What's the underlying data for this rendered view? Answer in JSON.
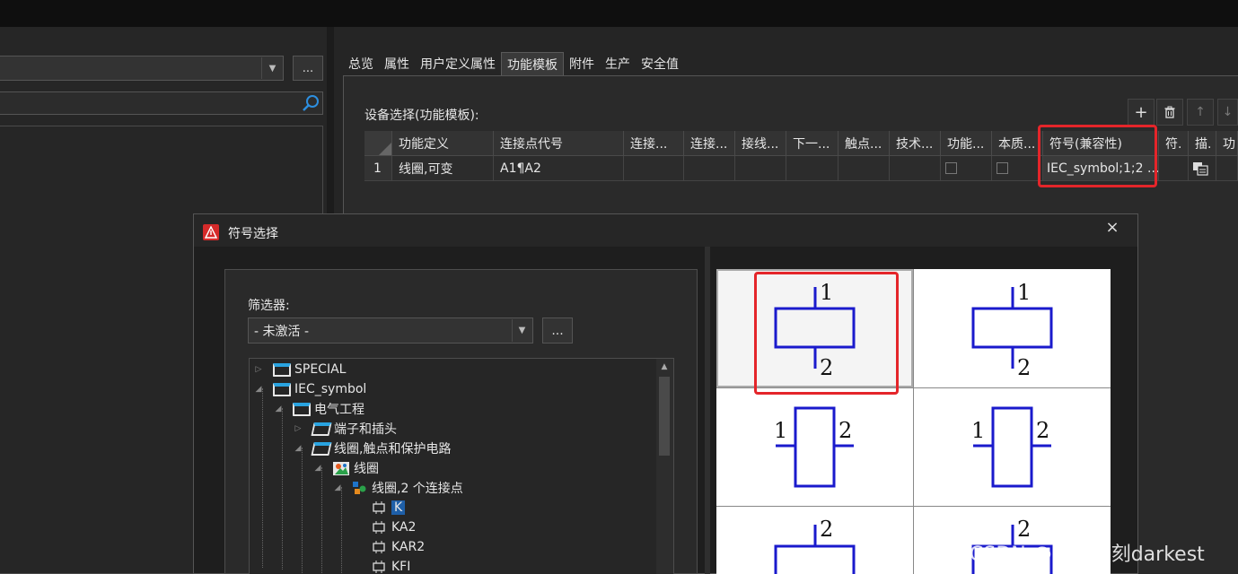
{
  "left_panel": {
    "combo_value": "",
    "more_label": "...",
    "search_placeholder": ""
  },
  "tabs": [
    {
      "label": "总览"
    },
    {
      "label": "属性"
    },
    {
      "label": "用户定义属性"
    },
    {
      "label": "功能模板",
      "active": true
    },
    {
      "label": "附件"
    },
    {
      "label": "生产"
    },
    {
      "label": "安全值"
    }
  ],
  "device_selection_label": "设备选择(功能模板):",
  "toolbar": {
    "add_icon": "+",
    "delete_icon": "trash-icon",
    "up_icon": "↑",
    "down_icon": "↓"
  },
  "grid": {
    "headers": [
      "功能定义",
      "连接点代号",
      "连接...",
      "连接...",
      "接线...",
      "下一...",
      "触点...",
      "技术...",
      "功能...",
      "本质...",
      "符号(兼容性)",
      "符.",
      "描.",
      "功"
    ],
    "row": {
      "index": "1",
      "function_definition": "线圈,可变",
      "connection_designation": "A1¶A2",
      "symbol_compat": "IEC_symbol;1;2 ..."
    }
  },
  "dialog": {
    "title": "符号选择",
    "close_icon": "×",
    "filter_label": "筛选器:",
    "filter_value": "- 未激活 -",
    "filter_more": "...",
    "tree": [
      {
        "label": "SPECIAL",
        "level": 0,
        "type": "folder",
        "expander": "▷"
      },
      {
        "label": "IEC_symbol",
        "level": 0,
        "type": "folder",
        "expander": "◢"
      },
      {
        "label": "电气工程",
        "level": 1,
        "type": "folder",
        "expander": "◢"
      },
      {
        "label": "端子和插头",
        "level": 2,
        "type": "folder-open",
        "expander": "▷"
      },
      {
        "label": "线圈,触点和保护电路",
        "level": 2,
        "type": "folder-open",
        "expander": "◢"
      },
      {
        "label": "线圈",
        "level": 3,
        "type": "image",
        "expander": "◢"
      },
      {
        "label": "线圈,2 个连接点",
        "level": 4,
        "type": "group",
        "expander": "◢"
      },
      {
        "label": "K",
        "level": 5,
        "type": "coil",
        "selected": true
      },
      {
        "label": "KA2",
        "level": 5,
        "type": "coil"
      },
      {
        "label": "KAR2",
        "level": 5,
        "type": "coil"
      },
      {
        "label": "KFI",
        "level": 5,
        "type": "coil"
      }
    ],
    "preview_cells": [
      {
        "orientation": "vertical",
        "top_pin": "1",
        "bottom_pin": "2"
      },
      {
        "orientation": "vertical",
        "top_pin": "1",
        "bottom_pin": "2"
      },
      {
        "orientation": "horizontal",
        "left_pin": "1",
        "right_pin": "2"
      },
      {
        "orientation": "horizontal",
        "left_pin": "1",
        "right_pin": "2"
      },
      {
        "orientation": "vertical",
        "top_pin": "2",
        "bottom_pin": ""
      },
      {
        "orientation": "vertical",
        "top_pin": "2",
        "bottom_pin": ""
      }
    ]
  },
  "watermark": "CSDN @至暗时刻darkest",
  "colors": {
    "accent_red": "#e4252a",
    "symbol_blue": "#1a1acc",
    "selection_blue": "#1e5fa8",
    "folder_blue": "#29a3e0"
  }
}
